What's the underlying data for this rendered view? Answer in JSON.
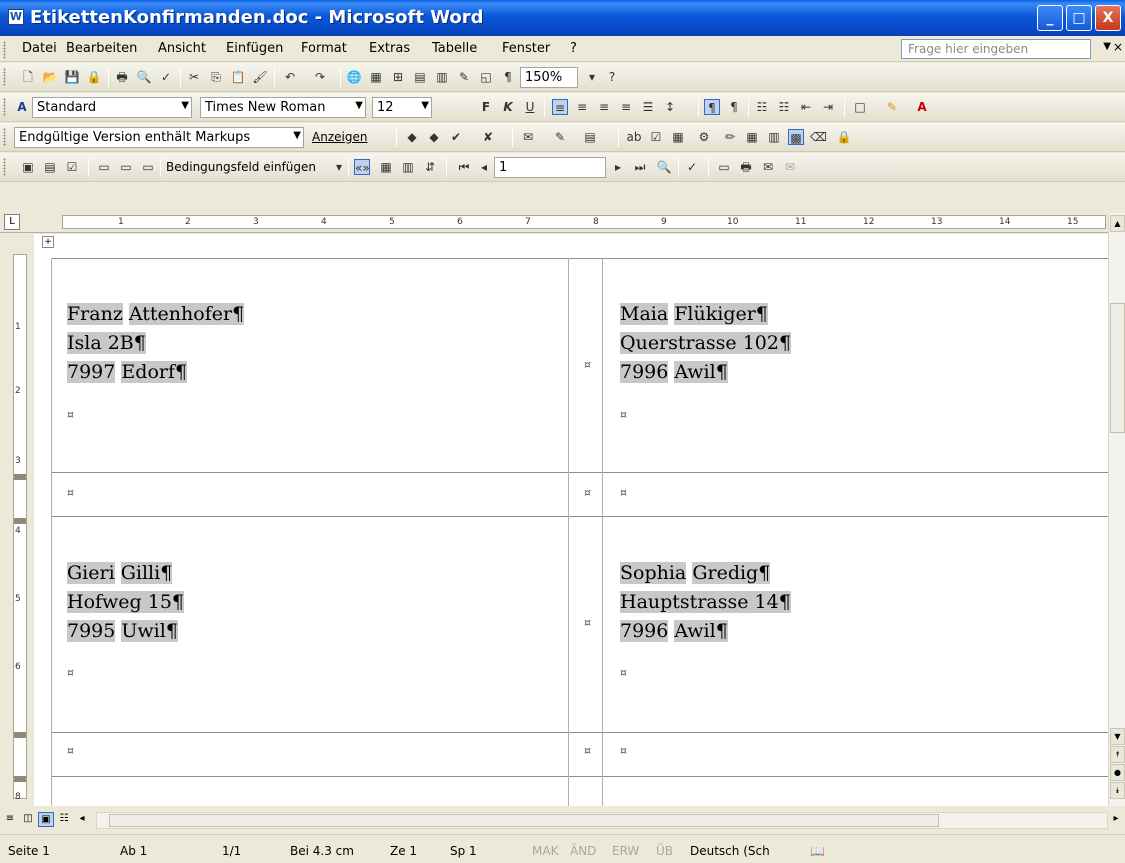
{
  "window": {
    "title": "EtikettenKonfirmanden.doc - Microsoft Word",
    "app_icon": "word-doc-icon",
    "buttons": {
      "minimize": "_",
      "maximize": "□",
      "close": "X"
    }
  },
  "menu": {
    "items": [
      "Datei",
      "Bearbeiten",
      "Ansicht",
      "Einfügen",
      "Format",
      "Extras",
      "Tabelle",
      "Fenster",
      "?"
    ],
    "help_placeholder": "Frage hier eingeben",
    "help_arrow": "▼",
    "close_doc": "×"
  },
  "toolbar_standard": {
    "zoom": "150%"
  },
  "toolbar_format": {
    "style": "Standard",
    "font": "Times New Roman",
    "size": "12",
    "bold": "F",
    "italic": "K",
    "underline": "U"
  },
  "toolbar_review": {
    "view_mode": "Endgültige Version enthält Markups",
    "show_label": "Anzeigen"
  },
  "toolbar_mailmerge": {
    "insert_field": "Bedingungsfeld einfügen",
    "record": "1"
  },
  "ruler": {
    "numbers": [
      "1",
      "2",
      "3",
      "4",
      "5",
      "6",
      "7",
      "8",
      "9",
      "10",
      "11",
      "12",
      "13",
      "14",
      "15"
    ]
  },
  "vruler": {
    "numbers": [
      "1",
      "2",
      "3",
      "4",
      "5",
      "6",
      "8"
    ]
  },
  "labels": [
    {
      "line1": "Franz",
      "line1b": "Attenhofer¶",
      "line2": "Isla 2B¶",
      "line3a": "7997",
      "line3b": "Edorf¶"
    },
    {
      "line1": "Maia",
      "line1b": "Flükiger¶",
      "line2": "Querstrasse 102¶",
      "line3a": "7996",
      "line3b": "Awil¶"
    },
    {
      "line1": "Gieri",
      "line1b": "Gilli¶",
      "line2": "Hofweg 15¶",
      "line3a": "7995",
      "line3b": "Uwil¶"
    },
    {
      "line1": "Sophia",
      "line1b": "Gredig¶",
      "line2": "Hauptstrasse 14¶",
      "line3a": "7996",
      "line3b": "Awil¶"
    }
  ],
  "end_of_cell": "¤",
  "status": {
    "page": "Seite 1",
    "section": "Ab 1",
    "pages": "1/1",
    "position": "Bei 4.3 cm",
    "line": "Ze 1",
    "column": "Sp 1",
    "mak": "MAK",
    "and": "ÄND",
    "erw": "ERW",
    "ub": "ÜB",
    "language": "Deutsch (Sch"
  }
}
